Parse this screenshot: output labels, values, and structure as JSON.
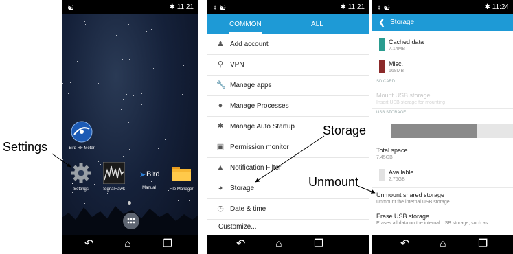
{
  "phone1": {
    "status_time": "11:21",
    "apps": [
      {
        "name": "Bird RF Meter"
      },
      {
        "name": "Settings"
      },
      {
        "name": "SignalHawk"
      },
      {
        "name": "Manual"
      },
      {
        "name": "File Manager"
      }
    ],
    "manual_logo_text": "Bird"
  },
  "phone2": {
    "status_time": "11:21",
    "tabs": [
      "COMMON",
      "ALL"
    ],
    "items": [
      {
        "label": "Add account",
        "icon": "person-add-icon"
      },
      {
        "label": "VPN",
        "icon": "key-icon"
      },
      {
        "label": "Manage apps",
        "icon": "wrench-icon"
      },
      {
        "label": "Manage Processes",
        "icon": "process-icon"
      },
      {
        "label": "Manage Auto Startup",
        "icon": "startup-icon"
      },
      {
        "label": "Permission monitor",
        "icon": "permission-icon"
      },
      {
        "label": "Notification Filter",
        "icon": "notification-icon"
      },
      {
        "label": "Storage",
        "icon": "storage-icon"
      },
      {
        "label": "Date & time",
        "icon": "clock-icon"
      }
    ],
    "customize": "Customize..."
  },
  "phone3": {
    "status_time": "11:24",
    "title": "Storage",
    "cached_label": "Cached data",
    "cached_size": "7.14MB",
    "cached_color": "#2a9c8f",
    "misc_label": "Misc.",
    "misc_size": "168MB",
    "misc_color": "#8b2a2a",
    "sd_card_header": "SD CARD",
    "mount_label": "Mount USB storage",
    "mount_sub": "Insert USB storage for mounting",
    "usb_header": "USB STORAGE",
    "usb_used_fraction": 0.7,
    "total_label": "Total space",
    "total_value": "7.45GB",
    "available_label": "Available",
    "available_value": "2.76GB",
    "unmount_label": "Unmount shared storage",
    "unmount_sub": "Unmount the internal USB storage",
    "erase_label": "Erase USB storage",
    "erase_sub": "Erases all data on the internal USB storage, such as"
  },
  "annotations": {
    "settings": "Settings",
    "storage": "Storage",
    "unmount": "Unmount"
  }
}
